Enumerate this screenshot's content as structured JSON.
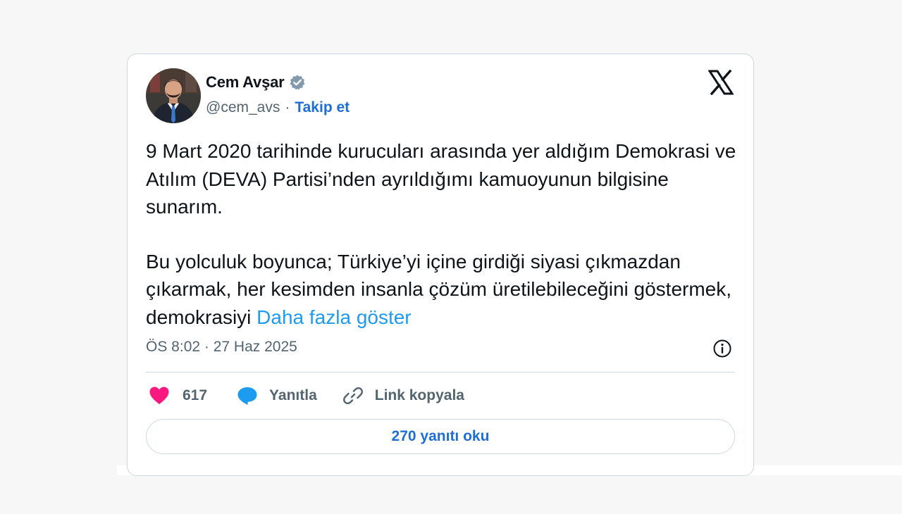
{
  "author": {
    "name": "Cem Avşar",
    "handle": "@cem_avs",
    "separator": "·",
    "follow_label": "Takip et",
    "verified_badge_color": "#829aab"
  },
  "tweet": {
    "paragraph_1": "9 Mart 2020 tarihinde kurucuları arasında yer aldığım Demokrasi ve Atılım (DEVA) Partisi’nden ayrıldığımı kamuoyunun bilgisine sunarım.",
    "paragraph_2": "Bu yolculuk boyunca; Türkiye’yi içine girdiği siyasi çıkmazdan çıkarmak, her kesimden insanla çözüm üretilebileceğini göstermek, demokrasiyi",
    "show_more_label": "Daha fazla göster",
    "timestamp": "ÖS 8:02 · 27 Haz 2025"
  },
  "actions": {
    "like_count": "617",
    "reply_label": "Yanıtla",
    "copy_link_label": "Link kopyala",
    "read_replies_label": "270 yanıtı oku"
  },
  "icons": {
    "platform_logo": "x-logo-icon",
    "verified": "verified-badge-icon",
    "info": "info-icon",
    "like": "heart-icon",
    "reply": "speech-bubble-icon",
    "copy_link": "link-icon"
  },
  "colors": {
    "accent": "#1d9bf0",
    "link_bold": "#1d6fd6",
    "like": "#f91880",
    "text": "#0f1419",
    "muted": "#536471",
    "border": "#cfd9de"
  }
}
